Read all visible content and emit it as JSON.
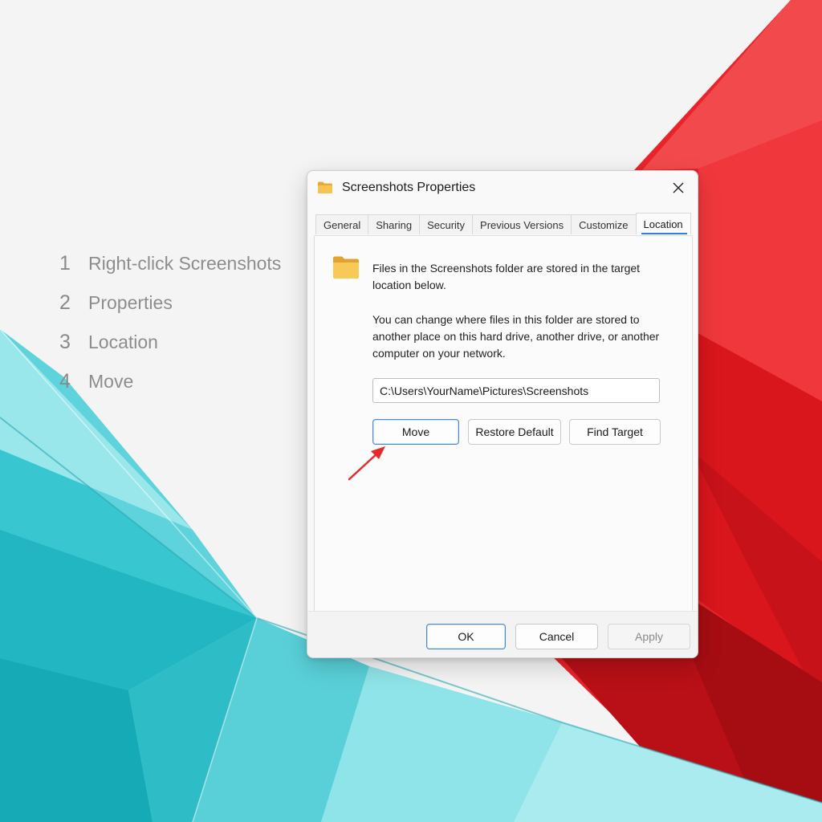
{
  "steps": [
    {
      "number": "1",
      "text": "Right-click Screenshots"
    },
    {
      "number": "2",
      "text": "Properties"
    },
    {
      "number": "3",
      "text": "Location"
    },
    {
      "number": "4",
      "text": "Move"
    }
  ],
  "dialog": {
    "title": "Screenshots Properties",
    "icons": {
      "title": "folder-icon",
      "close": "close-icon",
      "panel": "folder-icon"
    },
    "tabs": [
      {
        "label": "General",
        "active": false
      },
      {
        "label": "Sharing",
        "active": false
      },
      {
        "label": "Security",
        "active": false
      },
      {
        "label": "Previous Versions",
        "active": false
      },
      {
        "label": "Customize",
        "active": false
      },
      {
        "label": "Location",
        "active": true
      }
    ],
    "location": {
      "description": "Files in the Screenshots folder are stored in the target location below.",
      "hint": "You can change where files in this folder are stored to another place on this hard drive, another drive, or another computer on your network.",
      "path": "C:\\Users\\YourName\\Pictures\\Screenshots",
      "buttons": {
        "move": "Move",
        "restore_default": "Restore Default",
        "find_target": "Find Target"
      }
    },
    "footer": {
      "ok": "OK",
      "cancel": "Cancel",
      "apply": "Apply",
      "apply_enabled": false
    }
  },
  "colors": {
    "accent": "#2f7fd8",
    "arrow": "#e42a2a",
    "background_red": "#e01e22",
    "background_teal": "#37c8d2"
  }
}
